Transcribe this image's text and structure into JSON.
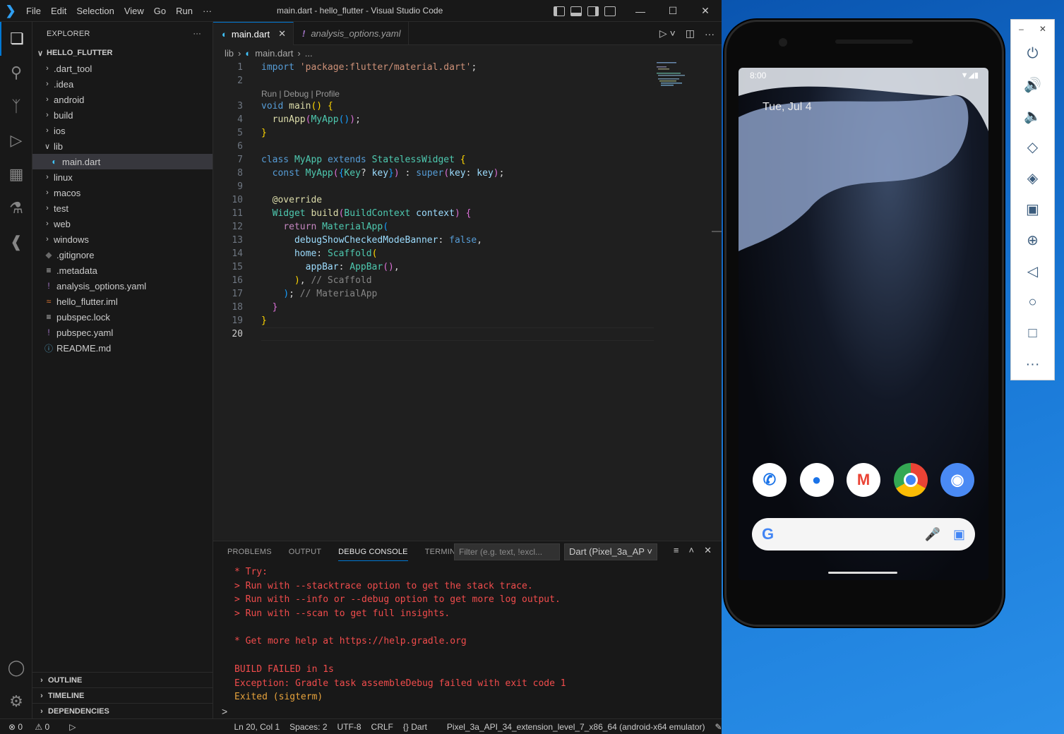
{
  "window": {
    "title": "main.dart - hello_flutter - Visual Studio Code"
  },
  "menu": [
    "File",
    "Edit",
    "Selection",
    "View",
    "Go",
    "Run",
    "···"
  ],
  "explorer": {
    "header": "EXPLORER",
    "root": "HELLO_FLUTTER",
    "items": [
      {
        "label": ".dart_tool",
        "kind": "folder",
        "depth": 1
      },
      {
        "label": ".idea",
        "kind": "folder",
        "depth": 1
      },
      {
        "label": "android",
        "kind": "folder",
        "depth": 1
      },
      {
        "label": "build",
        "kind": "folder",
        "depth": 1
      },
      {
        "label": "ios",
        "kind": "folder",
        "depth": 1
      },
      {
        "label": "lib",
        "kind": "folder-open",
        "depth": 1
      },
      {
        "label": "main.dart",
        "kind": "dart",
        "depth": 2,
        "selected": true
      },
      {
        "label": "linux",
        "kind": "folder",
        "depth": 1
      },
      {
        "label": "macos",
        "kind": "folder",
        "depth": 1
      },
      {
        "label": "test",
        "kind": "folder",
        "depth": 1
      },
      {
        "label": "web",
        "kind": "folder",
        "depth": 1
      },
      {
        "label": "windows",
        "kind": "folder",
        "depth": 1
      },
      {
        "label": ".gitignore",
        "kind": "git",
        "depth": 1
      },
      {
        "label": ".metadata",
        "kind": "lines",
        "depth": 1
      },
      {
        "label": "analysis_options.yaml",
        "kind": "yaml",
        "depth": 1
      },
      {
        "label": "hello_flutter.iml",
        "kind": "rss",
        "depth": 1
      },
      {
        "label": "pubspec.lock",
        "kind": "lines",
        "depth": 1
      },
      {
        "label": "pubspec.yaml",
        "kind": "yaml",
        "depth": 1
      },
      {
        "label": "README.md",
        "kind": "info",
        "depth": 1
      }
    ],
    "sections": [
      "OUTLINE",
      "TIMELINE",
      "DEPENDENCIES"
    ]
  },
  "tabs": [
    {
      "label": "main.dart",
      "active": true,
      "close": "✕"
    },
    {
      "label": "analysis_options.yaml",
      "active": false
    }
  ],
  "breadcrumb": [
    "lib",
    "main.dart",
    "..."
  ],
  "code": {
    "codelens": "Run | Debug | Profile",
    "line_numbers": [
      "1",
      "2",
      "3",
      "4",
      "5",
      "6",
      "7",
      "8",
      "9",
      "10",
      "11",
      "12",
      "13",
      "14",
      "15",
      "16",
      "17",
      "18",
      "19",
      "20"
    ],
    "current_line": "20"
  },
  "panel": {
    "tabs": [
      "PROBLEMS",
      "OUTPUT",
      "DEBUG CONSOLE",
      "TERMINAL"
    ],
    "active_tab": "DEBUG CONSOLE",
    "filter_placeholder": "Filter (e.g. text, !excl...",
    "target": "Dart (Pixel_3a_AP",
    "console_lines": [
      "* Try:",
      "> Run with --stacktrace option to get the stack trace.",
      "> Run with --info or --debug option to get more log output.",
      "> Run with --scan to get full insights.",
      "",
      "* Get more help at https://help.gradle.org",
      "",
      "BUILD FAILED in 1s",
      "Exception: Gradle task assembleDebug failed with exit code 1",
      "Exited (sigterm)"
    ],
    "prompt": ">"
  },
  "status": {
    "errors": "0",
    "warnings": "0",
    "position": "Ln 20, Col 1",
    "spaces": "Spaces: 2",
    "encoding": "UTF-8",
    "eol": "CRLF",
    "language": "Dart",
    "device": "Pixel_3a_API_34_extension_level_7_x86_64 (android-x64 emulator)"
  },
  "phone": {
    "time": "8:00",
    "date": "Tue, Jul 4",
    "apps": [
      "phone-app",
      "messages-app",
      "gmail-app",
      "chrome-app",
      "camera-app"
    ]
  },
  "emulator_toolbar": {
    "minimize": "–",
    "close": "✕",
    "buttons": [
      "power",
      "volume-up",
      "volume-down",
      "rotate-left",
      "rotate-right",
      "screenshot",
      "zoom",
      "back",
      "home",
      "overview",
      "more"
    ]
  },
  "colors": {
    "accent": "#0078d4",
    "error": "#f14c4c",
    "editor_bg": "#1f1f1f"
  }
}
